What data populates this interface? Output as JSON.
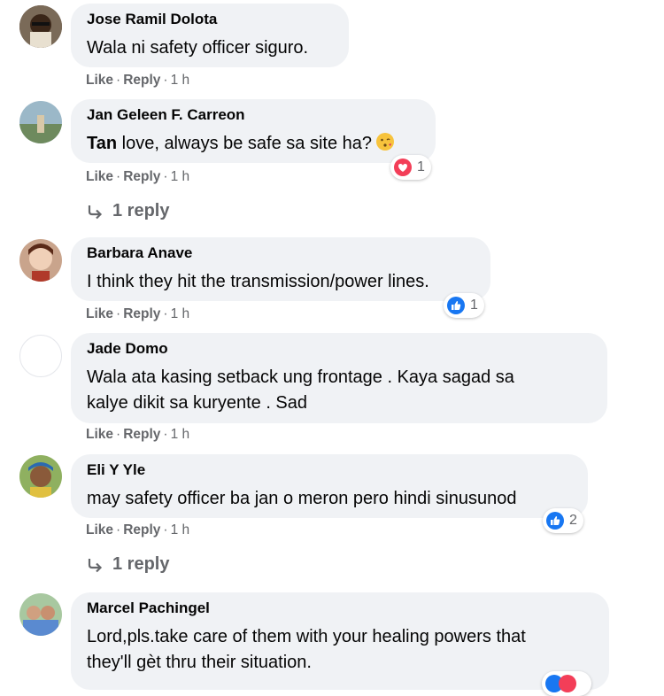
{
  "comments": [
    {
      "author": "Jose Ramil Dolota",
      "lines": [
        "Wala ni safety officer siguro."
      ],
      "like": "Like",
      "reply": "Reply",
      "time": "1 h"
    },
    {
      "author": "Jan Geleen F. Carreon",
      "tag": "Tan",
      "text_after": " love, always be safe sa site ha?",
      "like": "Like",
      "reply": "Reply",
      "time": "1 h",
      "reaction": {
        "icon": "love-icon",
        "count": "1"
      },
      "replies_label": "1 reply"
    },
    {
      "author": "Barbara Anave",
      "lines": [
        "I think they hit the transmission/power lines."
      ],
      "like": "Like",
      "reply": "Reply",
      "time": "1 h",
      "reaction": {
        "icon": "like-icon",
        "count": "1"
      }
    },
    {
      "author": "Jade Domo",
      "lines": [
        "Wala ata kasing setback ung frontage . Kaya sagad sa",
        "kalye dikit sa kuryente . Sad"
      ],
      "like": "Like",
      "reply": "Reply",
      "time": "1 h"
    },
    {
      "author": "Eli Y Yle",
      "lines": [
        "may safety officer ba jan o meron pero hindi sinusunod"
      ],
      "like": "Like",
      "reply": "Reply",
      "time": "1 h",
      "reaction": {
        "icon": "like-icon",
        "count": "2"
      },
      "replies_label": "1 reply"
    },
    {
      "author": "Marcel Pachingel",
      "lines": [
        "Lord,pls.take care of them with your healing powers that",
        "they'll gèt thru their situation."
      ]
    }
  ],
  "colors": {
    "bubble": "#f0f2f5",
    "meta": "#65676b",
    "like_blue": "#1877f2",
    "love_red": "#f33e58"
  }
}
